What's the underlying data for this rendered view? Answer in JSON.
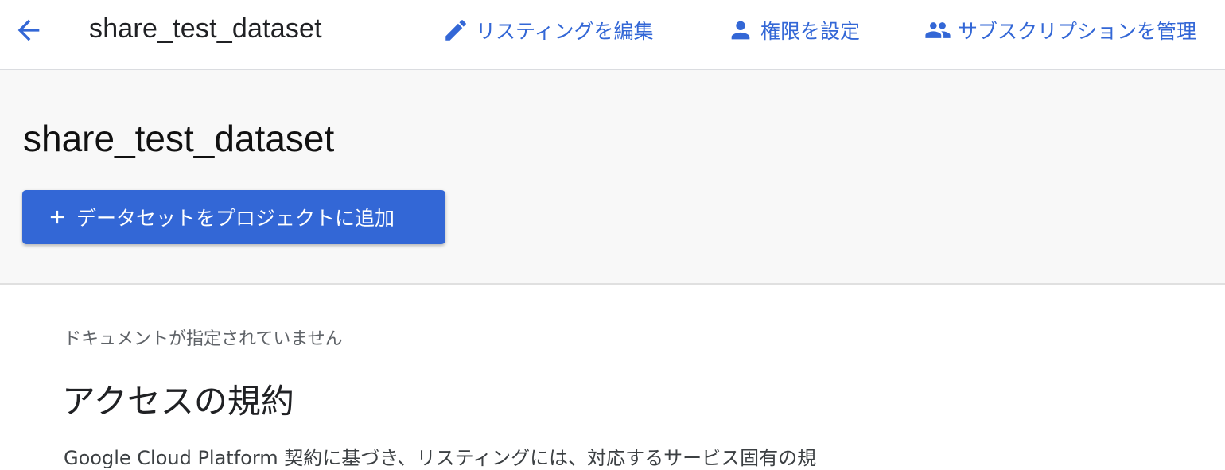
{
  "header": {
    "title": "share_test_dataset",
    "back_icon": "arrow-back-icon",
    "actions": [
      {
        "label": "リスティングを編集",
        "icon": "pencil-icon"
      },
      {
        "label": "権限を設定",
        "icon": "person-icon"
      },
      {
        "label": "サブスクリプションを管理",
        "icon": "people-icon"
      }
    ]
  },
  "hero": {
    "title": "share_test_dataset",
    "add_button_label": "データセットをプロジェクトに追加"
  },
  "content": {
    "no_document": "ドキュメントが指定されていません",
    "terms_heading": "アクセスの規約",
    "terms_text": "Google Cloud Platform 契約に基づき、リスティングには、対応するサービス固有の規"
  },
  "colors": {
    "accent": "#3367d6",
    "hero_bg": "#f8f8f8",
    "muted_text": "#5f6368"
  }
}
